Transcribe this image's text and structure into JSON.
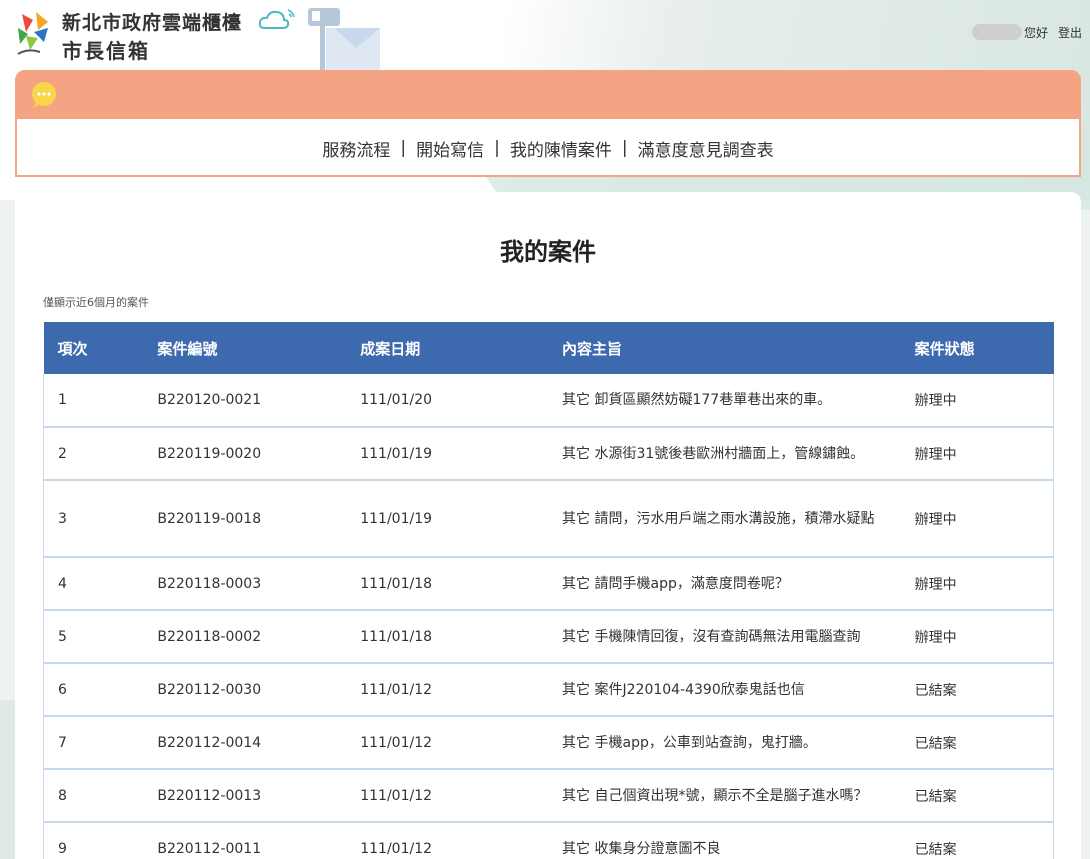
{
  "header": {
    "site_title": "新北市政府雲端櫃檯",
    "site_subtitle": "市長信箱",
    "greeting": "您好",
    "logout": "登出"
  },
  "nav": {
    "links": [
      "服務流程",
      "開始寫信",
      "我的陳情案件",
      "滿意度意見調查表"
    ],
    "separator": "|"
  },
  "page": {
    "title": "我的案件",
    "note": "僅顯示近6個月的案件"
  },
  "table": {
    "headers": [
      "項次",
      "案件編號",
      "成案日期",
      "內容主旨",
      "案件狀態"
    ],
    "rows": [
      {
        "no": "1",
        "case_id": "B220120-0021",
        "date": "111/01/20",
        "subject": "其它 卸貨區顯然妨礙177巷單巷出來的車。",
        "status": "辦理中"
      },
      {
        "no": "2",
        "case_id": "B220119-0020",
        "date": "111/01/19",
        "subject": "其它 水源街31號後巷歐洲村牆面上，管線鏽蝕。",
        "status": "辦理中"
      },
      {
        "no": "3",
        "case_id": "B220119-0018",
        "date": "111/01/19",
        "subject": "其它 請問，污水用戶端之雨水溝設施，積滯水疑點",
        "status": "辦理中"
      },
      {
        "no": "4",
        "case_id": "B220118-0003",
        "date": "111/01/18",
        "subject": "其它 請問手機app，滿意度問卷呢？",
        "status": "辦理中"
      },
      {
        "no": "5",
        "case_id": "B220118-0002",
        "date": "111/01/18",
        "subject": "其它 手機陳情回復，沒有查詢碼無法用電腦查詢",
        "status": "辦理中"
      },
      {
        "no": "6",
        "case_id": "B220112-0030",
        "date": "111/01/12",
        "subject": "其它 案件J220104-4390欣泰鬼話也信",
        "status": "已結案"
      },
      {
        "no": "7",
        "case_id": "B220112-0014",
        "date": "111/01/12",
        "subject": "其它 手機app，公車到站查詢，鬼打牆。",
        "status": "已結案"
      },
      {
        "no": "8",
        "case_id": "B220112-0013",
        "date": "111/01/12",
        "subject": "其它 自己個資出現*號，顯示不全是腦子進水嗎？",
        "status": "已結案"
      },
      {
        "no": "9",
        "case_id": "B220112-0011",
        "date": "111/01/12",
        "subject": "其它 收集身分證意圖不良",
        "status": "已結案"
      }
    ]
  },
  "colors": {
    "nav_accent": "#f4a383",
    "table_header": "#3d6aae",
    "row_border": "#c6d8ec"
  }
}
